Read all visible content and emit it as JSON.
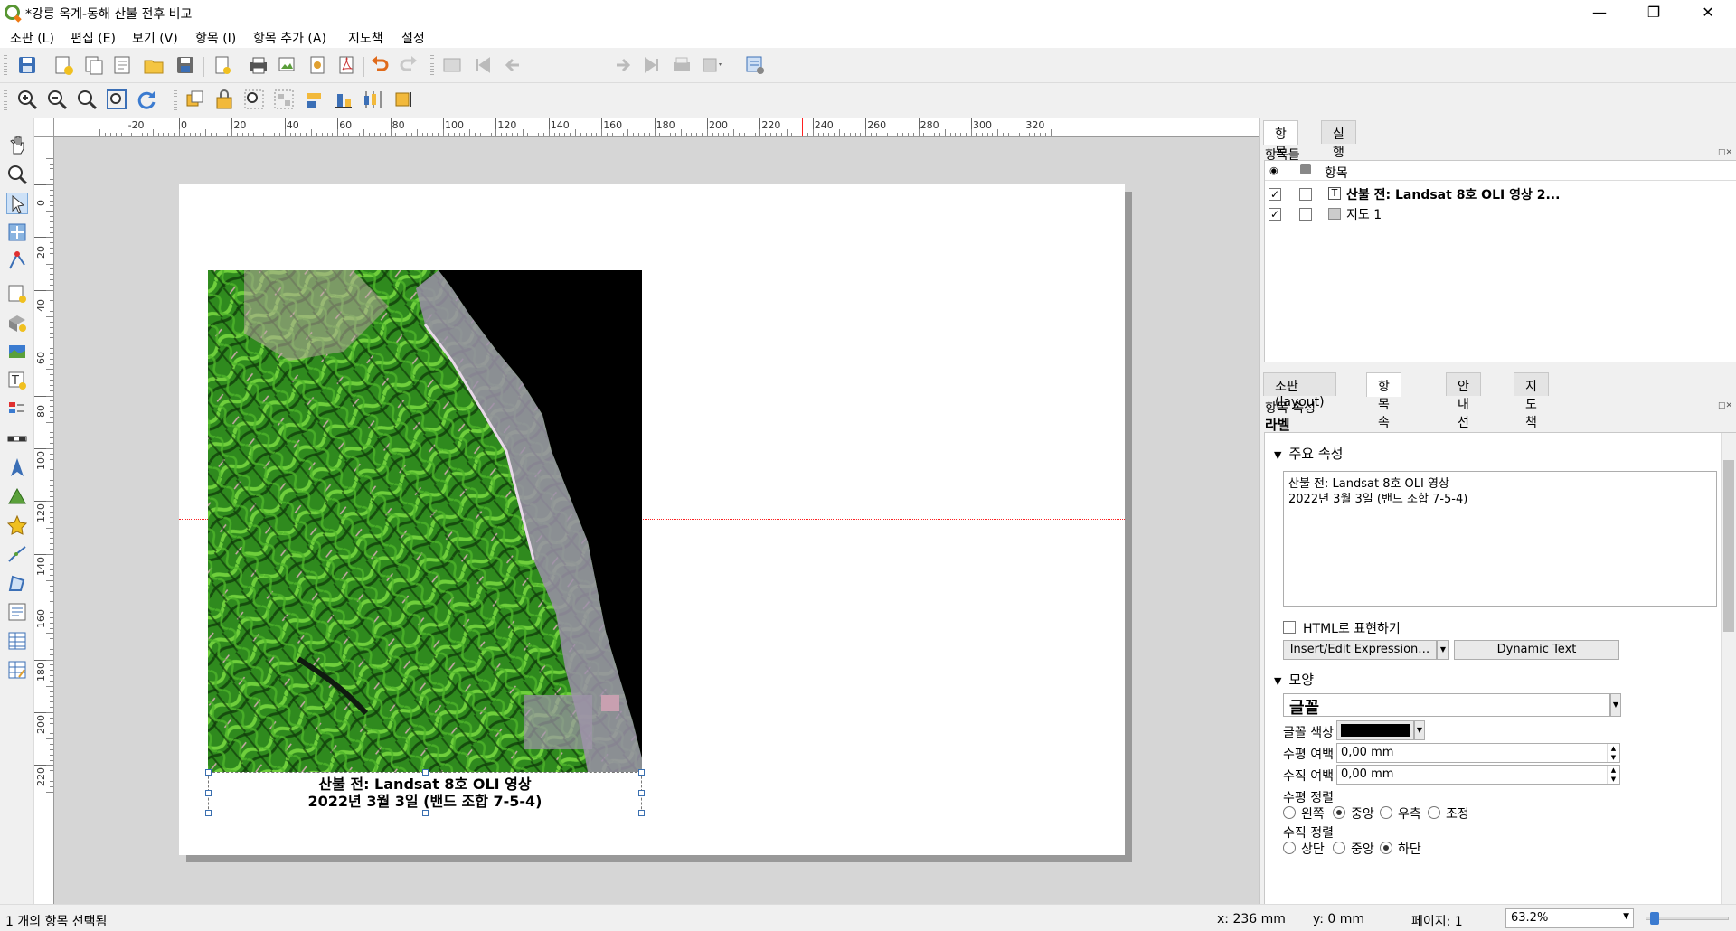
{
  "window": {
    "title": "*강릉 옥계-동해 산불 전후 비교",
    "minimize_glyph": "—",
    "restore_glyph": "❐",
    "close_glyph": "✕"
  },
  "menu": [
    "조판 (L)",
    "편집 (E)",
    "보기 (V)",
    "항목 (I)",
    "항목 추가 (A)",
    "지도책",
    "설정"
  ],
  "toolbar": {
    "page_value": "1"
  },
  "rulers": {
    "h_ticks": [
      "-20",
      "0",
      "20",
      "40",
      "60",
      "80",
      "100",
      "120",
      "140",
      "160",
      "180",
      "200",
      "220",
      "240",
      "260",
      "280",
      "300",
      "320"
    ],
    "v_ticks": [
      "0",
      "20",
      "40",
      "60",
      "80",
      "100",
      "120",
      "140",
      "160",
      "180",
      "200",
      "220"
    ]
  },
  "layout": {
    "label_line1": "산불 전: Landsat 8호 OLI 영상",
    "label_line2": "2022년 3월 3일 (밴드 조합 7-5-4)"
  },
  "items_panel": {
    "tabs": [
      "항목들",
      "실행취소 이력"
    ],
    "title": "항목들",
    "column_item": "항목",
    "rows": [
      {
        "name": "산불 전: Landsat 8호 OLI 영상 2...",
        "visible": true,
        "locked": false,
        "type": "label"
      },
      {
        "name": "지도 1",
        "visible": true,
        "locked": false,
        "type": "map"
      }
    ],
    "check_glyph": "✓"
  },
  "props_panel": {
    "tabs": [
      "조판(layout)",
      "항목 속성",
      "안내선",
      "지도책"
    ],
    "title": "항목 속성",
    "item_type": "라벨",
    "main_section": "주요 속성",
    "label_text": "산불 전: Landsat 8호 OLI 영상\n2022년 3월 3일 (밴드 조합 7-5-4)",
    "html_checkbox": "HTML로 표현하기",
    "insert_expression": "Insert/Edit Expression…",
    "dynamic_text": "Dynamic Text",
    "appearance_section": "모양",
    "font_button": "글꼴",
    "font_color_label": "글꼴 색상",
    "font_color": "#000000",
    "h_margin_label": "수평 여백",
    "h_margin_value": "0,00 mm",
    "v_margin_label": "수직 여백",
    "v_margin_value": "0,00 mm",
    "h_align_label": "수평 정렬",
    "h_align_options": [
      "왼쪽",
      "중앙",
      "우측",
      "조정"
    ],
    "h_align_selected": "중앙",
    "v_align_label": "수직 정렬",
    "v_align_options": [
      "상단",
      "중앙",
      "하단"
    ],
    "v_align_selected": "하단"
  },
  "status": {
    "selection": "1 개의 항목 선택됨",
    "x": "x: 236 mm",
    "y": "y: 0 mm",
    "page": "페이지: 1",
    "zoom": "63.2%"
  },
  "colors": {
    "accent": "#3a6fb0",
    "guide": "#ff2020",
    "qgis_green": "#589632",
    "vegetation": "#2f8a1e"
  }
}
